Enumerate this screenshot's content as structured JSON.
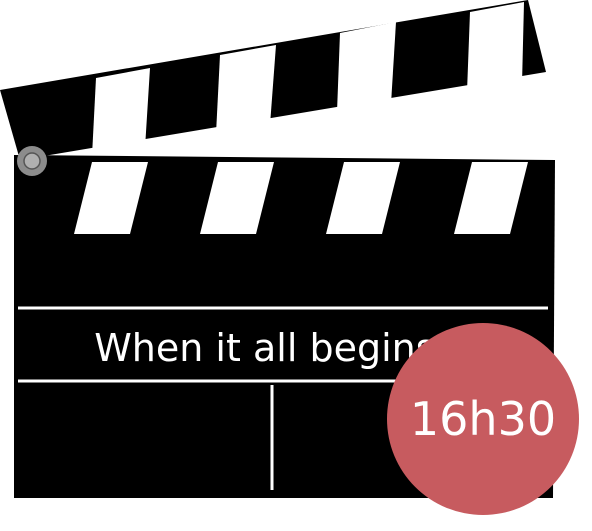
{
  "clapperboard": {
    "caption": "When it all begins...",
    "colors": {
      "board": "#000000",
      "stripe": "#ffffff",
      "hinge": "#8c8c8c"
    }
  },
  "badge": {
    "time": "16h30",
    "color": "#c75b5f"
  }
}
